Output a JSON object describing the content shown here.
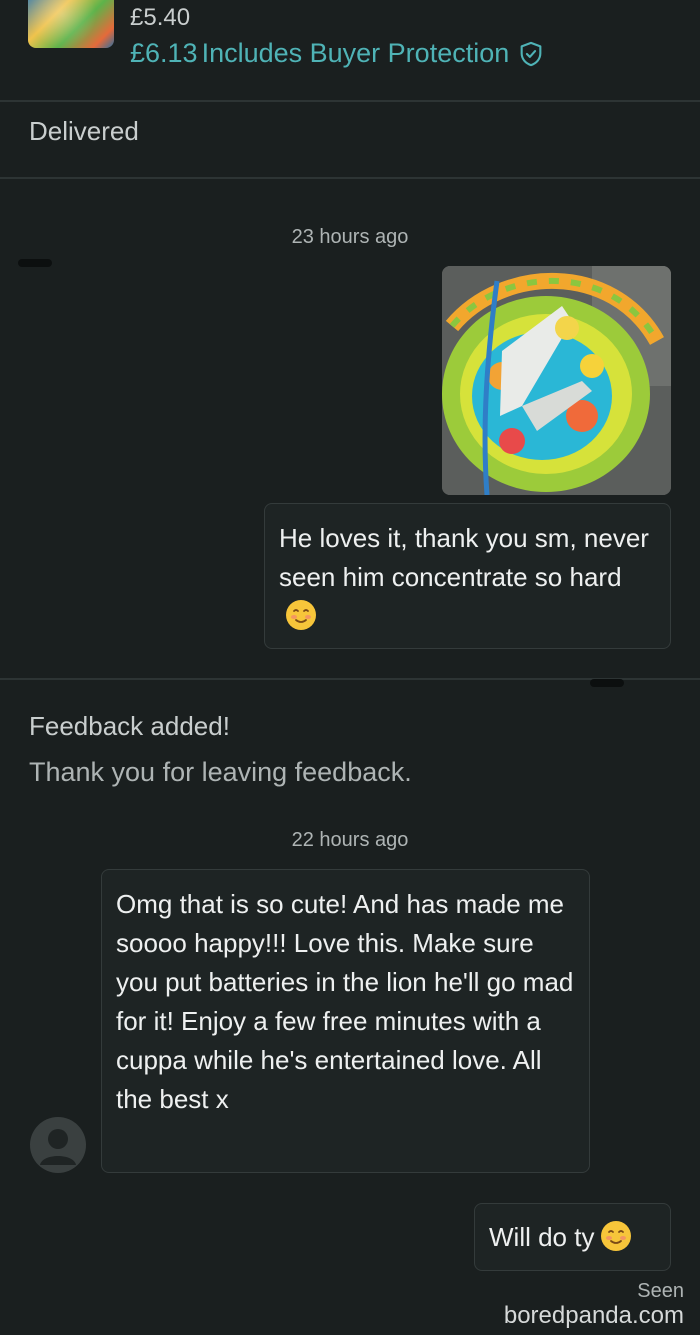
{
  "order": {
    "item_price": "£5.40",
    "total_price": "£6.13",
    "total_note": "Includes Buyer Protection",
    "protection_icon": "shield-check-icon"
  },
  "status": {
    "delivered_label": "Delivered"
  },
  "messages": [
    {
      "timestamp": "23 hours ago",
      "sender": "me",
      "has_photo": true,
      "text": "He loves it, thank you sm, never seen him concentrate so hard",
      "emoji": "smiling-face-icon"
    },
    {
      "timestamp": "22 hours ago",
      "sender": "other",
      "text": "Omg that is so cute! And has made me soooo happy!!! Love this. Make sure you put batteries in the lion he'll go mad for it! Enjoy a few free minutes with a cuppa while he's entertained love. All the best x"
    },
    {
      "sender": "me",
      "text": "Will do ty",
      "emoji": "smiling-face-icon"
    }
  ],
  "feedback": {
    "title": "Feedback added!",
    "subtitle": "Thank you for leaving feedback."
  },
  "read_receipt": "Seen",
  "watermark": "boredpanda.com",
  "colors": {
    "background": "#1a1f1f",
    "accent": "#4fb3b6",
    "bubble_border": "#343b3b"
  }
}
